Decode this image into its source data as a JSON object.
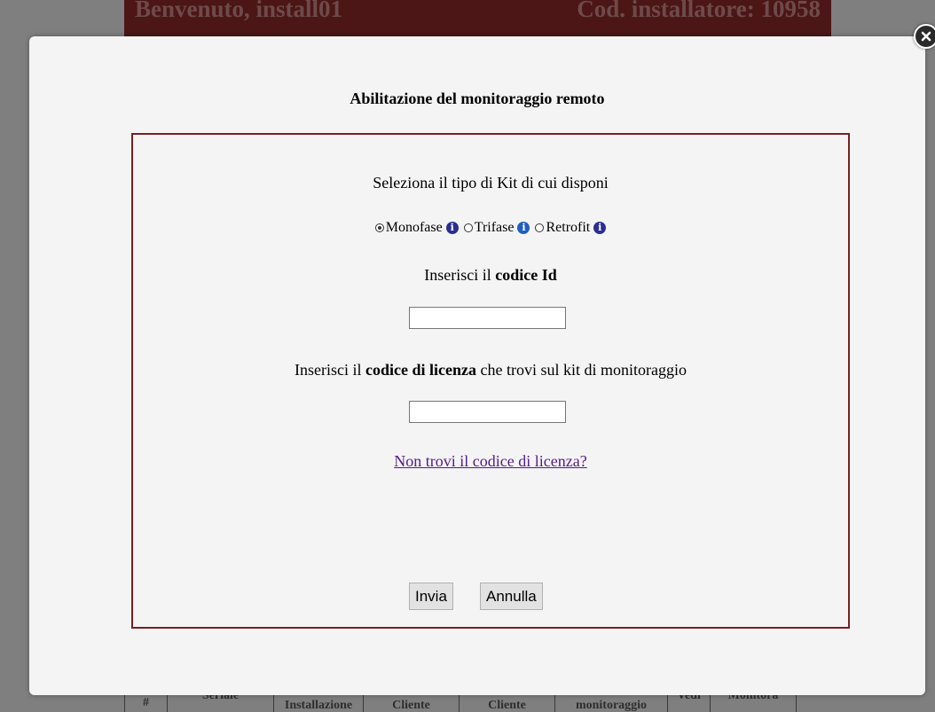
{
  "background": {
    "header_left": "Benvenuto, install01",
    "header_right": "Cod. installatore: 10958",
    "table_headers": [
      "#",
      "Seriale",
      "Installazione",
      "Cliente",
      "Cliente",
      "monitoraggio",
      "Vedi",
      "Monitora"
    ]
  },
  "modal": {
    "title": "Abilitazione del monitoraggio remoto",
    "kit_prompt": "Seleziona il tipo di Kit di cui disponi",
    "radio_options": [
      {
        "label": "Monofase",
        "checked": true,
        "info_icon": "info-icon"
      },
      {
        "label": "Trifase",
        "checked": false,
        "info_icon": "info-icon"
      },
      {
        "label": "Retrofit",
        "checked": false,
        "info_icon": "info-icon"
      }
    ],
    "id_prompt_prefix": "Inserisci il ",
    "id_prompt_bold": "codice Id",
    "id_input_value": "",
    "license_prompt_prefix": "Inserisci il ",
    "license_prompt_bold": "codice di licenza",
    "license_prompt_suffix": " che trovi sul kit di monitoraggio",
    "license_input_value": "",
    "help_link": "Non trovi il codice di licenza?",
    "submit_label": "Invia",
    "cancel_label": "Annulla",
    "close_icon": "close-icon"
  },
  "colors": {
    "panel_border": "#7a1f1f",
    "header_bg": "#4c1616",
    "link": "#551a8b",
    "info_icon": "#2a2e8f"
  }
}
